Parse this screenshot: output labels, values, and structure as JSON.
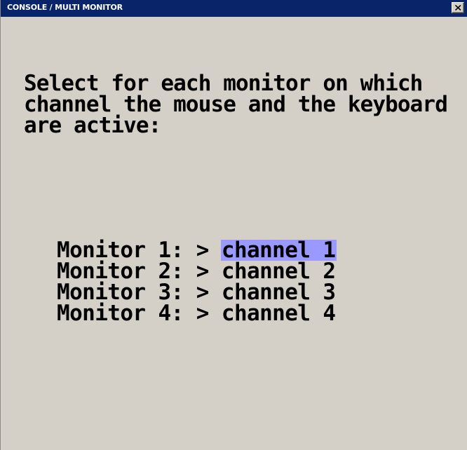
{
  "window": {
    "title": "CONSOLE / MULTI MONITOR",
    "close_icon": "close-x-icon"
  },
  "instruction": "Select for each monitor on which channel the mouse and the keyboard are active:",
  "monitors": [
    {
      "label": "Monitor 1:",
      "arrow": ">",
      "channel": "channel 1",
      "selected": true
    },
    {
      "label": "Monitor 2:",
      "arrow": ">",
      "channel": "channel 2",
      "selected": false
    },
    {
      "label": "Monitor 3:",
      "arrow": ">",
      "channel": "channel 3",
      "selected": false
    },
    {
      "label": "Monitor 4:",
      "arrow": ">",
      "channel": "channel 4",
      "selected": false
    }
  ],
  "colors": {
    "title_bar": "#0a246a",
    "background": "#d4d0c8",
    "selection_highlight": "#9999ff"
  }
}
